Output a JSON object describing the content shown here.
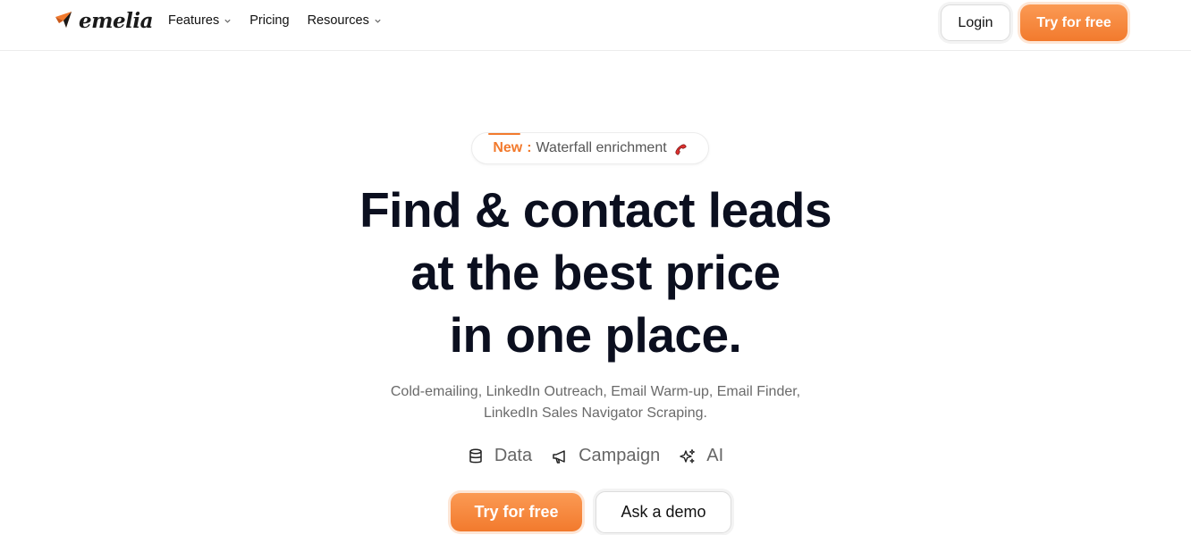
{
  "header": {
    "logo_text": "emelia",
    "nav": [
      {
        "label": "Features",
        "has_dropdown": true
      },
      {
        "label": "Pricing",
        "has_dropdown": false
      },
      {
        "label": "Resources",
        "has_dropdown": true
      }
    ],
    "login_label": "Login",
    "try_label": "Try for free"
  },
  "hero": {
    "badge": {
      "new_label": "New",
      "separator": ":",
      "text": "Waterfall enrichment",
      "icon": "phone-icon"
    },
    "headline_lines": [
      "Find & contact leads",
      "at the best price",
      "in one place."
    ],
    "subtitle": "Cold-emailing, LinkedIn Outreach, Email Warm-up, Email Finder, LinkedIn Sales Navigator Scraping.",
    "pillars": [
      {
        "label": "Data",
        "icon": "database-icon"
      },
      {
        "label": "Campaign",
        "icon": "megaphone-icon"
      },
      {
        "label": "AI",
        "icon": "sparkles-icon"
      }
    ],
    "cta_primary": "Try for free",
    "cta_secondary": "Ask a demo"
  },
  "colors": {
    "accent": "#f27a2d",
    "accent_light": "#fb9a54",
    "text_dark": "#0b0f1f",
    "text_muted": "#6a6a6a"
  }
}
